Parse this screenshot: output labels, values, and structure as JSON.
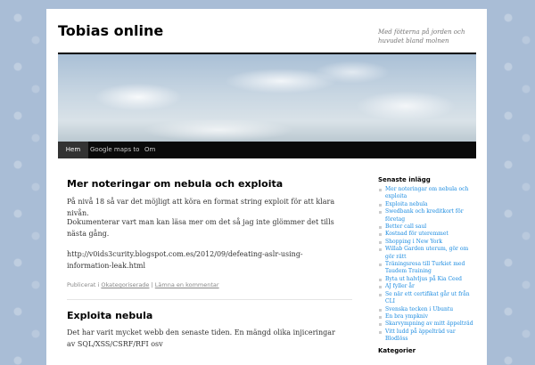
{
  "site": {
    "title": "Tobias online",
    "tagline": "Med fötterna på jorden och huvudet bland molnen"
  },
  "nav": {
    "items": [
      {
        "label": "Hem",
        "active": true
      },
      {
        "label": "Google maps to"
      },
      {
        "label": "Om"
      }
    ]
  },
  "posts": [
    {
      "title": "Mer noteringar om nebula och exploita",
      "paragraphs": [
        "På nivå 18 så var det möjligt att köra en format string exploit för att klara nivån.",
        "Dokumenterar vart man kan läsa mer om det så jag inte glömmer det tills nästa gång.",
        "http://v0ids3curity.blogspot.com.es/2012/09/defeating-aslr-using-information-leak.html"
      ],
      "meta": {
        "prefix": "Publicerat i",
        "category": "Okategoriserade",
        "separator": "|",
        "comment_link": "Lämna en kommentar"
      }
    },
    {
      "title": "Exploita nebula",
      "paragraphs": [
        "Det har varit mycket webb den senaste tiden. En mängd olika injiceringar av SQL/XSS/CSRF/RFI osv"
      ]
    }
  ],
  "sidebar": {
    "heading": "Senaste inlägg",
    "items": [
      "Mer noteringar om nebula och exploita",
      "Exploita nebula",
      "Swedbank och kreditkort för företag",
      "Better call saul",
      "Kostnad för uteremmet",
      "Shopping i New York",
      "Willab Garden uterum, gör om gör rätt",
      "Träningsresa till Turkiet med Taudem Training",
      "Byta ut halvljus på Kia Ceed",
      "AJ fyller år",
      "Se när ett certifikat går ut från CLI",
      "Svenska tecken i Ubuntu",
      "En bra ympkniv",
      "Skarvympning av mitt äppelträd",
      "Vitt ludd på äppelträd var Blodlöss"
    ],
    "next_heading": "Kategorier"
  }
}
